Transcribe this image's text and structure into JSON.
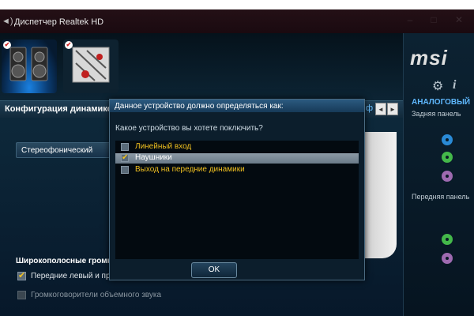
{
  "window": {
    "title": "Диспетчер Realtek HD",
    "minimize_glyph": "–",
    "maximize_glyph": "□",
    "close_glyph": "✕"
  },
  "tabs": [
    {
      "id": "speakers",
      "active": true
    },
    {
      "id": "microphone",
      "active": false
    }
  ],
  "main": {
    "section_title": "Конфигурация динамиков",
    "header_partial": "ф",
    "nav_prev": "◄",
    "nav_next": "►",
    "speaker_config_dropdown": "Стереофонический",
    "fullrange_group_label": "Широкополосные громко",
    "fullrange_options": [
      {
        "label": "Передние левый и пра",
        "checked": true,
        "enabled": true
      },
      {
        "label": "Громкоговорители объемного звука",
        "checked": false,
        "enabled": false
      }
    ]
  },
  "sidebar": {
    "logo": "msi",
    "gear_glyph": "⚙",
    "info_glyph": "i",
    "section_title": "АНАЛОГОВЫЙ",
    "rear_panel_label": "Задняя панель",
    "front_panel_label": "Передняя панель",
    "rear_jacks": [
      {
        "name": "jack-blue",
        "color": "#2a8ad6"
      },
      {
        "name": "jack-green",
        "color": "#44b84a"
      },
      {
        "name": "jack-pink",
        "color": "#9e6ab0"
      }
    ],
    "front_jacks": [
      {
        "name": "jack-green",
        "color": "#44b84a"
      },
      {
        "name": "jack-pink",
        "color": "#9e6ab0"
      }
    ]
  },
  "dialog": {
    "title": "Данное устройство должно определяться как:",
    "question": "Какое устройство вы хотете поключить?",
    "options": [
      {
        "label": "Линейный вход",
        "checked": false,
        "selected": false,
        "color": "#f0c020"
      },
      {
        "label": "Наушники",
        "checked": true,
        "selected": true,
        "color": "#ffffff"
      },
      {
        "label": "Выход на передние динамики",
        "checked": false,
        "selected": false,
        "color": "#f0c020"
      }
    ],
    "ok_label": "OK"
  },
  "colors": {
    "accent_blue": "#5fb8ff",
    "option_yellow": "#f0c020",
    "window_bg": "#0a1a26"
  }
}
